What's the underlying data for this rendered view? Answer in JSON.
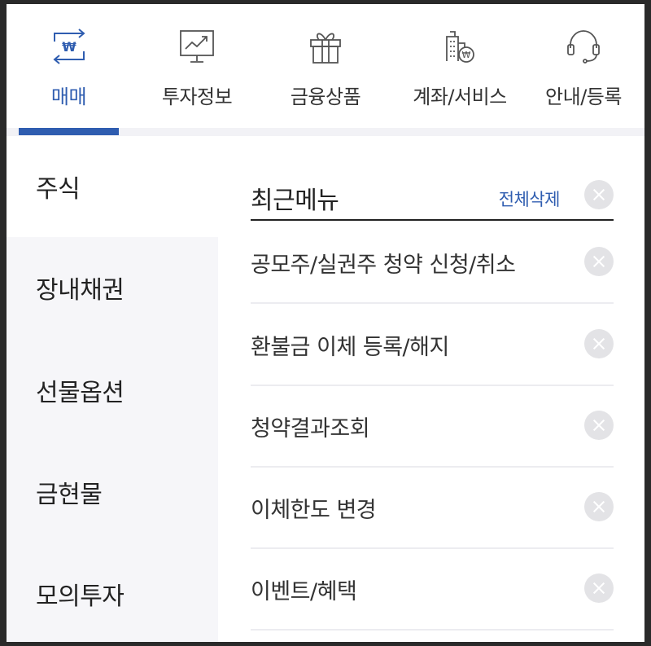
{
  "tabs": [
    {
      "label": "매매",
      "icon": "won-transfer-icon",
      "active": true
    },
    {
      "label": "투자정보",
      "icon": "chart-monitor-icon",
      "active": false
    },
    {
      "label": "금융상품",
      "icon": "gift-icon",
      "active": false
    },
    {
      "label": "계좌/서비스",
      "icon": "building-won-icon",
      "active": false
    },
    {
      "label": "안내/등록",
      "icon": "headset-icon",
      "active": false
    }
  ],
  "colors": {
    "accent": "#2f5db0",
    "sidebar_bg": "#f6f6f9",
    "text": "#222222",
    "divider": "#ececf0"
  },
  "sidebar": {
    "items": [
      {
        "label": "주식",
        "active": true
      },
      {
        "label": "장내채권",
        "active": false
      },
      {
        "label": "선물옵션",
        "active": false
      },
      {
        "label": "금현물",
        "active": false
      },
      {
        "label": "모의투자",
        "active": false
      }
    ]
  },
  "recent": {
    "title": "최근메뉴",
    "clear_all": "전체삭제",
    "items": [
      {
        "label": "공모주/실권주 청약 신청/취소"
      },
      {
        "label": "환불금 이체 등록/해지"
      },
      {
        "label": "청약결과조회"
      },
      {
        "label": "이체한도 변경"
      },
      {
        "label": "이벤트/혜택"
      }
    ]
  }
}
